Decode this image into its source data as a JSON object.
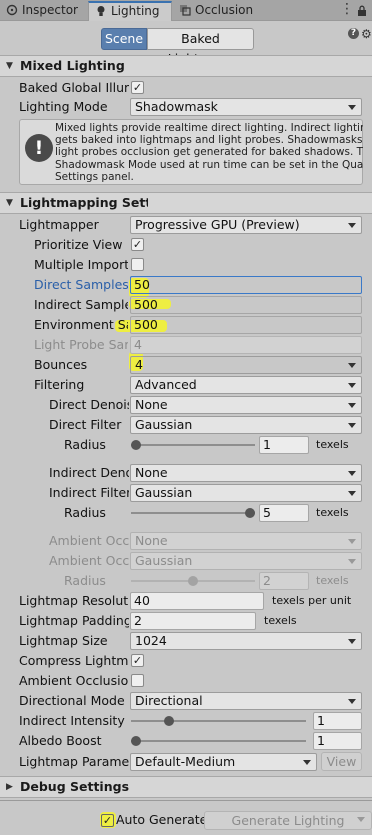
{
  "tabs": [
    {
      "label": "Inspector",
      "icon": "inspector-icon"
    },
    {
      "label": "Lighting",
      "icon": "lightbulb-icon"
    },
    {
      "label": "Occlusion",
      "icon": "occlusion-icon"
    }
  ],
  "toolbar": {
    "scene_label": "Scene",
    "baked_label": "Baked Lightmaps"
  },
  "mixed": {
    "header": "Mixed Lighting",
    "baked_gi_label": "Baked Global Illumination",
    "baked_gi_checked": true,
    "lighting_mode_label": "Lighting Mode",
    "lighting_mode_value": "Shadowmask",
    "info_text_lines": [
      "Mixed lights provide realtime direct lighting. Indirect lighting",
      "gets baked into lightmaps and light probes. Shadowmasks and",
      "light probes occlusion get generated for baked shadows. The",
      "Shadowmask Mode used at run time can be set in the Quality",
      "Settings panel."
    ]
  },
  "lightmapping": {
    "header": "Lightmapping Settings",
    "lightmapper_label": "Lightmapper",
    "lightmapper_value": "Progressive GPU (Preview)",
    "prioritize_label": "Prioritize View",
    "prioritize_checked": true,
    "multiple_label": "Multiple Importance Sampling",
    "multiple_checked": false,
    "direct_samples_label": "Direct Samples",
    "direct_samples_value": "50",
    "indirect_samples_label": "Indirect Samples",
    "indirect_samples_value": "500",
    "environment_samples_label": "Environment Samples",
    "environment_samples_value": "500",
    "light_probe_label": "Light Probe Sample Multiplier",
    "light_probe_value": "4",
    "bounces_label": "Bounces",
    "bounces_value": "4",
    "filtering_label": "Filtering",
    "filtering_value": "Advanced",
    "direct_denoiser_label": "Direct Denoiser",
    "direct_denoiser_value": "None",
    "direct_filter_label": "Direct Filter",
    "direct_filter_value": "Gaussian",
    "radius_label": "Radius",
    "direct_radius_value": "1",
    "direct_radius_fraction": 0.0,
    "texels_label": "texels",
    "indirect_denoiser_label": "Indirect Denoiser",
    "indirect_denoiser_value": "None",
    "indirect_filter_label": "Indirect Filter",
    "indirect_filter_value": "Gaussian",
    "indirect_radius_value": "5",
    "indirect_radius_fraction": 1.0,
    "ao_denoiser_label": "Ambient Occlusion Denoiser",
    "ao_denoiser_value": "None",
    "ao_filter_label": "Ambient Occlusion Filter",
    "ao_filter_value": "Gaussian",
    "ao_radius_value": "2",
    "ao_radius_fraction": 0.5,
    "resolution_label": "Lightmap Resolution",
    "resolution_value": "40",
    "resolution_unit": "texels per unit",
    "padding_label": "Lightmap Padding",
    "padding_value": "2",
    "padding_unit": "texels",
    "size_label": "Lightmap Size",
    "size_value": "1024",
    "compress_label": "Compress Lightmaps",
    "compress_checked": true,
    "ao_label": "Ambient Occlusion",
    "ao_checked": false,
    "directional_label": "Directional Mode",
    "directional_value": "Directional",
    "indirect_intensity_label": "Indirect Intensity",
    "indirect_intensity_value": "1",
    "indirect_intensity_fraction": 0.2,
    "albedo_label": "Albedo Boost",
    "albedo_value": "1",
    "albedo_fraction": 0.0,
    "params_label": "Lightmap Parameters",
    "params_value": "Default-Medium",
    "view_label": "View"
  },
  "debug": {
    "header": "Debug Settings"
  },
  "footer": {
    "auto_label": "Auto Generate",
    "auto_checked": true,
    "generate_label": "Generate Lighting"
  },
  "colors": {
    "accent": "#5a7fae",
    "highlight": "#f5f52a",
    "link": "#2a5fa8"
  }
}
